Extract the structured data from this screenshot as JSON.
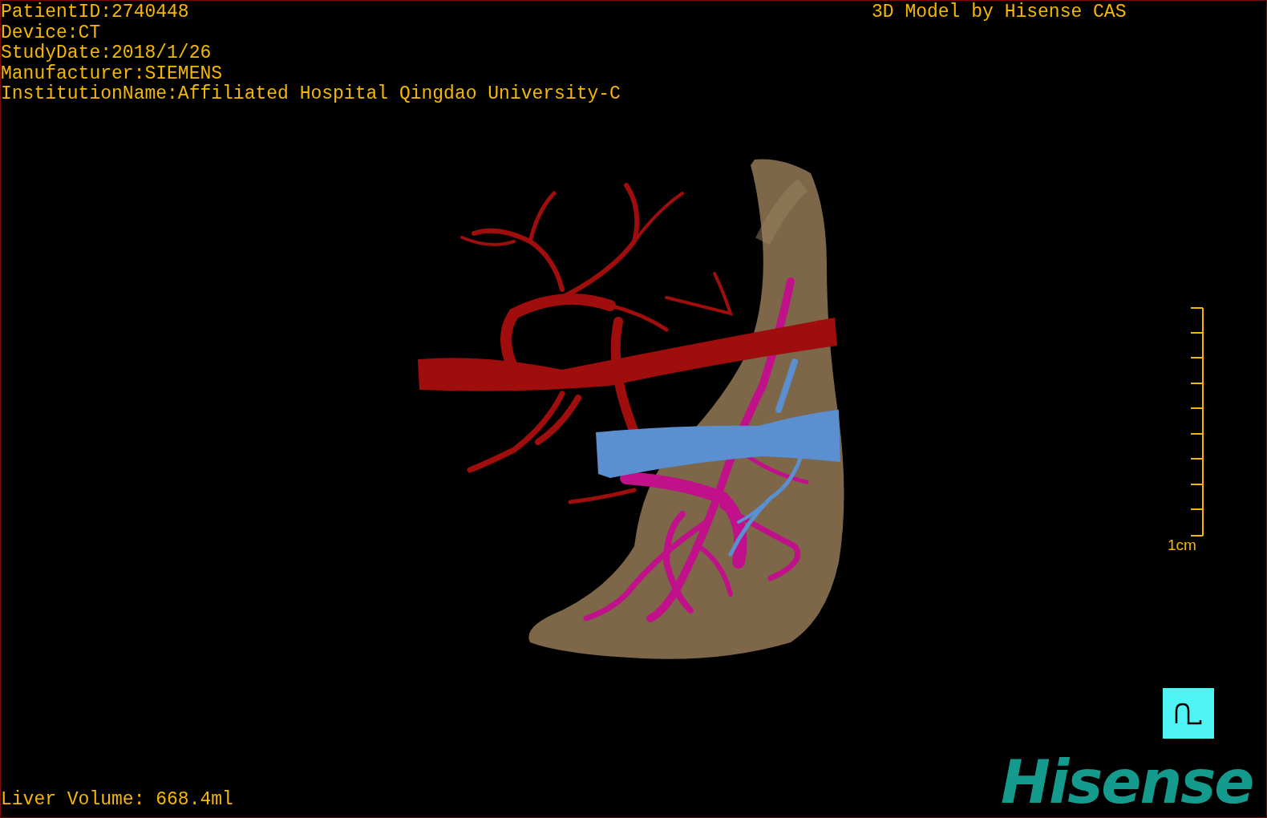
{
  "header_info": [
    "PatientID:2740448",
    "Device:CT",
    "StudyDate:2018/1/26",
    "Manufacturer:SIEMENS",
    "InstitutionName:Affiliated Hospital Qingdao University-C"
  ],
  "caption": "3D Model by Hisense CAS",
  "scale_bar": {
    "label": "1cm"
  },
  "footer": {
    "volume": "Liver Volume: 668.4ml"
  },
  "logo": "Hisense"
}
